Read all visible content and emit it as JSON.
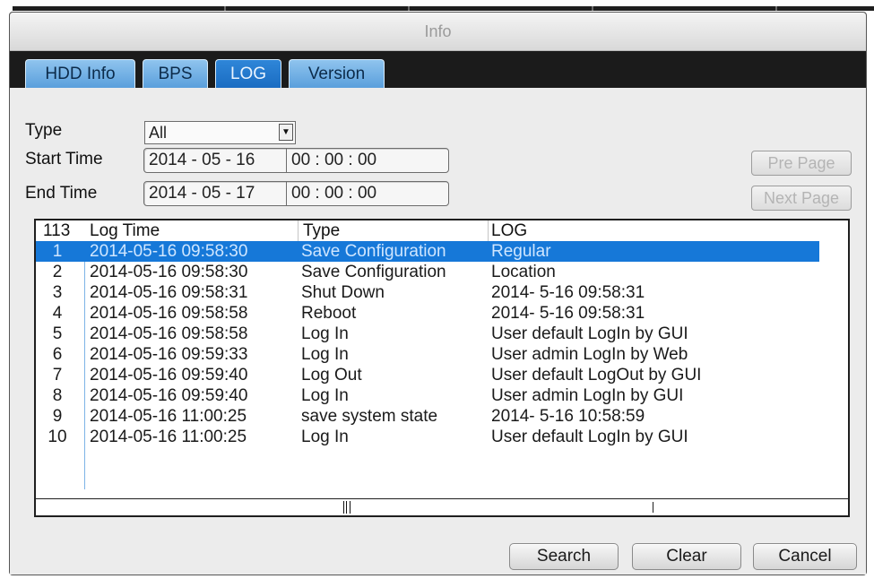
{
  "window": {
    "title": "Info"
  },
  "tabs": [
    {
      "label": "HDD Info",
      "active": false
    },
    {
      "label": "BPS",
      "active": false
    },
    {
      "label": "LOG",
      "active": true
    },
    {
      "label": "Version",
      "active": false
    }
  ],
  "filters": {
    "type_label": "Type",
    "type_value": "All",
    "start_label": "Start Time",
    "start_date": "2014 - 05 - 16",
    "start_time": "00 : 00 : 00",
    "end_label": "End Time",
    "end_date": "2014 - 05 - 17",
    "end_time": "00 : 00 : 00"
  },
  "paging": {
    "prev": "Pre Page",
    "next": "Next Page"
  },
  "table": {
    "count": "113",
    "columns": [
      "Log Time",
      "Type",
      "LOG"
    ],
    "rows": [
      {
        "num": "1",
        "time": "2014-05-16 09:58:30",
        "type": "Save Configuration",
        "log": "Regular",
        "selected": true
      },
      {
        "num": "2",
        "time": "2014-05-16 09:58:30",
        "type": "Save Configuration",
        "log": "Location"
      },
      {
        "num": "3",
        "time": "2014-05-16 09:58:31",
        "type": "Shut Down",
        "log": "2014- 5-16 09:58:31"
      },
      {
        "num": "4",
        "time": "2014-05-16 09:58:58",
        "type": "Reboot",
        "log": "2014- 5-16 09:58:31"
      },
      {
        "num": "5",
        "time": "2014-05-16 09:58:58",
        "type": "Log In",
        "log": "User default LogIn by GUI"
      },
      {
        "num": "6",
        "time": "2014-05-16 09:59:33",
        "type": "Log In",
        "log": "User admin LogIn by Web"
      },
      {
        "num": "7",
        "time": "2014-05-16 09:59:40",
        "type": "Log Out",
        "log": "User default LogOut by GUI"
      },
      {
        "num": "8",
        "time": "2014-05-16 09:59:40",
        "type": "Log In",
        "log": "User admin LogIn by GUI"
      },
      {
        "num": "9",
        "time": "2014-05-16 11:00:25",
        "type": "save system state",
        "log": "2014- 5-16 10:58:59"
      },
      {
        "num": "10",
        "time": "2014-05-16 11:00:25",
        "type": "Log In",
        "log": "User default LogIn by GUI"
      }
    ]
  },
  "actions": {
    "search": "Search",
    "clear": "Clear",
    "cancel": "Cancel"
  },
  "colors": {
    "selection": "#1678d8",
    "tab_active": "#1a6cc2",
    "tab_inactive": "#5a9fdc",
    "tabbar_bg": "#1b1b1b"
  }
}
